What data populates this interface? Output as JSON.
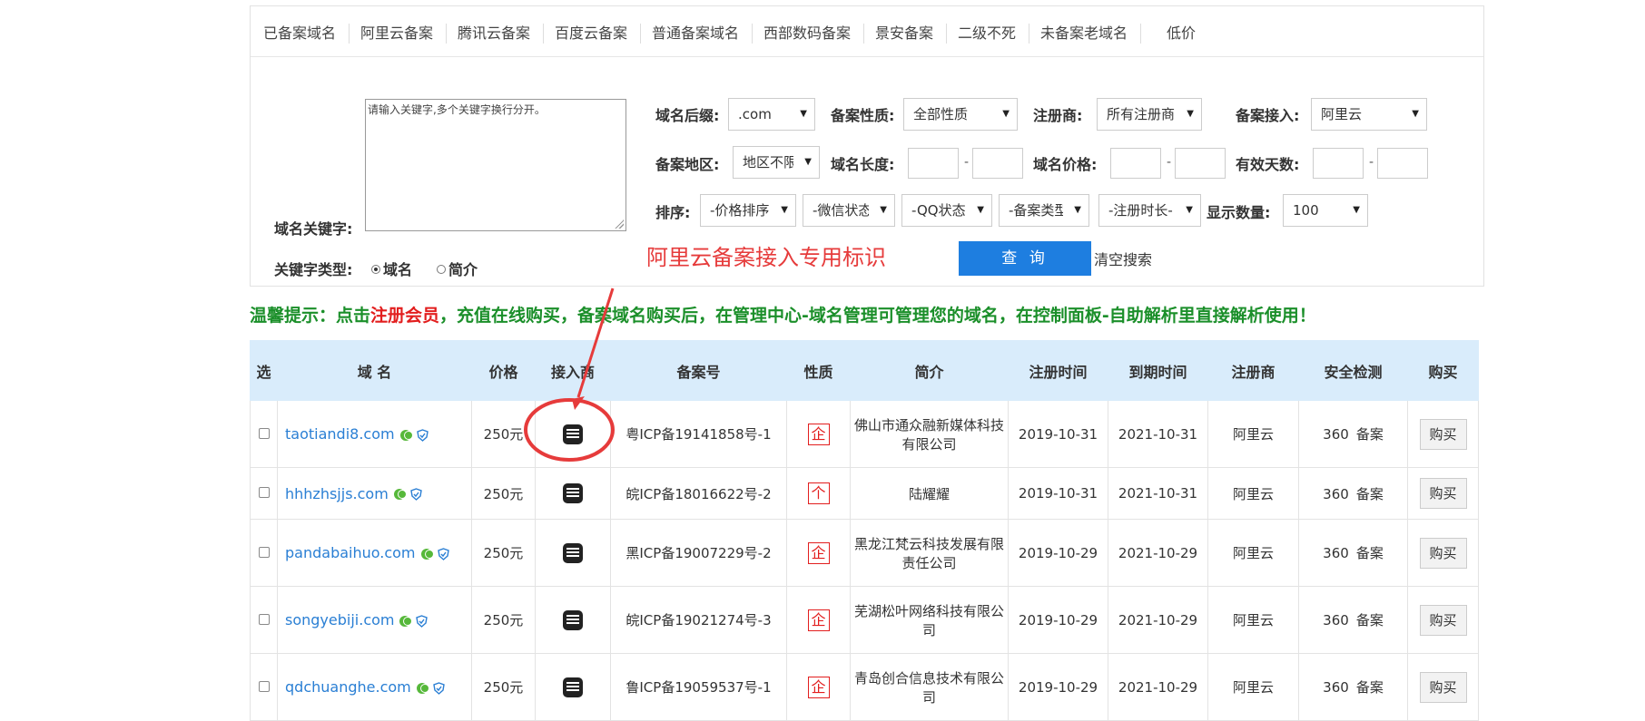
{
  "tabs": [
    "已备案域名",
    "阿里云备案",
    "腾讯云备案",
    "百度云备案",
    "普通备案域名",
    "西部数码备案",
    "景安备案",
    "二级不死",
    "未备案老域名",
    "低价"
  ],
  "search": {
    "keyword_label": "域名关键字:",
    "keyword_placeholder": "请输入关键字,多个关键字换行分开。",
    "keyword_type_label": "关键字类型:",
    "keyword_type_options": [
      "域名",
      "简介"
    ],
    "suffix_label": "域名后缀:",
    "suffix_value": ".com",
    "nature_label": "备案性质:",
    "nature_value": "全部性质",
    "registrar_label": "注册商:",
    "registrar_value": "所有注册商",
    "access_label": "备案接入:",
    "access_value": "阿里云",
    "region_label": "备案地区:",
    "region_value": "地区不限",
    "length_label": "域名长度:",
    "price_label": "域名价格:",
    "days_label": "有效天数:",
    "dash": "-",
    "sort_label": "排序:",
    "sort_options": [
      "-价格排序-",
      "-微信状态-",
      "-QQ状态-",
      "-备案类型-",
      "-注册时长-"
    ],
    "count_label": "显示数量:",
    "count_value": "100",
    "query_button": "查 询",
    "clear_button": "清空搜索"
  },
  "annotation": "阿里云备案接入专用标识",
  "tip": {
    "part1": "温馨提示：点击",
    "link": "注册会员",
    "part2": "，充值在线购买，备案域名购买后，在管理中心-域名管理可管理您的域名，在控制面板-自助解析里直接解析使用！"
  },
  "table": {
    "headers": [
      "选",
      "域 名",
      "价格",
      "接入商",
      "备案号",
      "性质",
      "简介",
      "注册时间",
      "到期时间",
      "注册商",
      "安全检测",
      "购买"
    ],
    "rows": [
      {
        "domain": "taotiandi8.com",
        "price": "250元",
        "icp": "粤ICP备19141858号-1",
        "type": "企",
        "intro": "佛山市通众融新媒体科技有限公司",
        "reg": "2019-10-31",
        "exp": "2021-10-31",
        "registrar": "阿里云",
        "check1": "360",
        "check2": "备案",
        "buy": "购买"
      },
      {
        "domain": "hhhzhsjjs.com",
        "price": "250元",
        "icp": "皖ICP备18016622号-2",
        "type": "个",
        "intro": "陆耀耀",
        "reg": "2019-10-31",
        "exp": "2021-10-31",
        "registrar": "阿里云",
        "check1": "360",
        "check2": "备案",
        "buy": "购买"
      },
      {
        "domain": "pandabaihuo.com",
        "price": "250元",
        "icp": "黑ICP备19007229号-2",
        "type": "企",
        "intro": "黑龙江梵云科技发展有限责任公司",
        "reg": "2019-10-29",
        "exp": "2021-10-29",
        "registrar": "阿里云",
        "check1": "360",
        "check2": "备案",
        "buy": "购买"
      },
      {
        "domain": "songyebiji.com",
        "price": "250元",
        "icp": "皖ICP备19021274号-3",
        "type": "企",
        "intro": "芜湖松叶网络科技有限公司",
        "reg": "2019-10-29",
        "exp": "2021-10-29",
        "registrar": "阿里云",
        "check1": "360",
        "check2": "备案",
        "buy": "购买"
      },
      {
        "domain": "qdchuanghe.com",
        "price": "250元",
        "icp": "鲁ICP备19059537号-1",
        "type": "企",
        "intro": "青岛创合信息技术有限公司",
        "reg": "2019-10-29",
        "exp": "2021-10-29",
        "registrar": "阿里云",
        "check1": "360",
        "check2": "备案",
        "buy": "购买"
      }
    ]
  },
  "colors": {
    "accent": "#1e7ee0",
    "annotation": "#e63b3b",
    "tip": "#1b8f2a",
    "link": "#2a7fd4",
    "header_bg": "#d9ecfb"
  },
  "icons": {
    "wechat": "wechat-icon",
    "qq": "qq-shield-icon",
    "aliyun": "aliyun-logo-icon"
  }
}
